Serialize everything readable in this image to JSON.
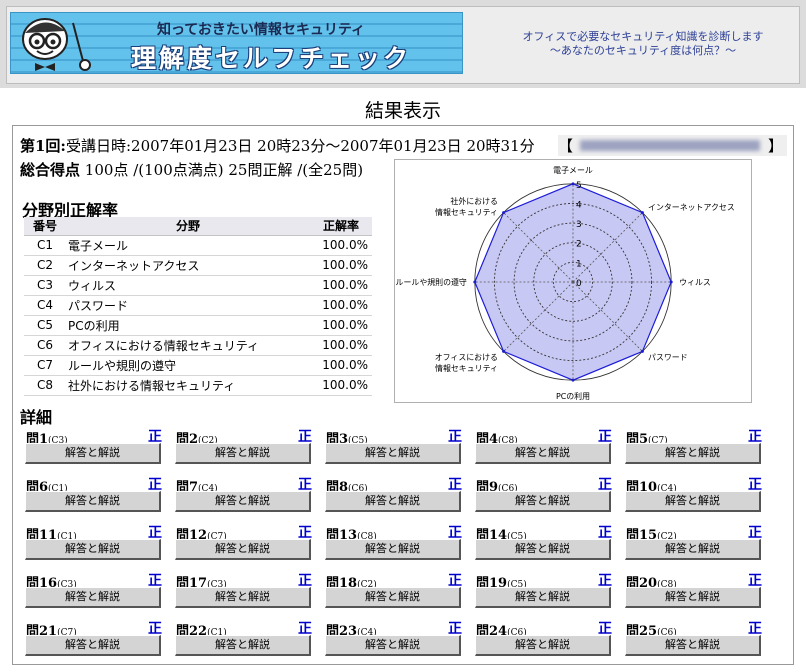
{
  "header": {
    "banner_subtitle": "知っておきたい情報セキュリティ",
    "banner_title": "理解度セルフチェック",
    "tagline_line1": "オフィスで必要なセキュリティ知識を診断します",
    "tagline_line2": "～あなたのセキュリティ度は何点？～"
  },
  "page_title": "結果表示",
  "session": {
    "label": "第1回:",
    "text": "受講日時:2007年01月23日 20時23分～2007年01月23日 20時31分",
    "email_open": "【",
    "email_close": "】"
  },
  "score": {
    "label": "総合得点",
    "text": "100点 /(100点満点) 25問正解 /(全25問)"
  },
  "rates": {
    "heading": "分野別正解率",
    "columns": [
      "番号",
      "分野",
      "正解率"
    ],
    "rows": [
      {
        "num": "C1",
        "name": "電子メール",
        "rate": "100.0%"
      },
      {
        "num": "C2",
        "name": "インターネットアクセス",
        "rate": "100.0%"
      },
      {
        "num": "C3",
        "name": "ウィルス",
        "rate": "100.0%"
      },
      {
        "num": "C4",
        "name": "パスワード",
        "rate": "100.0%"
      },
      {
        "num": "C5",
        "name": "PCの利用",
        "rate": "100.0%"
      },
      {
        "num": "C6",
        "name": "オフィスにおける情報セキュリティ",
        "rate": "100.0%"
      },
      {
        "num": "C7",
        "name": "ルールや規則の遵守",
        "rate": "100.0%"
      },
      {
        "num": "C8",
        "name": "社外における情報セキュリティ",
        "rate": "100.0%"
      }
    ]
  },
  "radar": {
    "axes": [
      "電子メール",
      "インターネットアクセス",
      "ウィルス",
      "パスワード",
      "PCの利用",
      "オフィスにおける\n情報セキュリティ",
      "ルールや規則の遵守",
      "社外における\n情報セキュリティ"
    ],
    "values": [
      5,
      5,
      5,
      5,
      5,
      5,
      5,
      5
    ],
    "max": 5,
    "ticks": [
      "0",
      "1",
      "2",
      "3",
      "4",
      "5"
    ],
    "fill_color": "#c8c8f4",
    "line_color": "#1c1cd8"
  },
  "details": {
    "heading": "詳細",
    "button_label": "解答と解説",
    "questions": [
      {
        "label": "問1",
        "cat": "(C3)",
        "mark": "正"
      },
      {
        "label": "問2",
        "cat": "(C2)",
        "mark": "正"
      },
      {
        "label": "問3",
        "cat": "(C5)",
        "mark": "正"
      },
      {
        "label": "問4",
        "cat": "(C8)",
        "mark": "正"
      },
      {
        "label": "問5",
        "cat": "(C7)",
        "mark": "正"
      },
      {
        "label": "問6",
        "cat": "(C1)",
        "mark": "正"
      },
      {
        "label": "問7",
        "cat": "(C4)",
        "mark": "正"
      },
      {
        "label": "問8",
        "cat": "(C6)",
        "mark": "正"
      },
      {
        "label": "問9",
        "cat": "(C6)",
        "mark": "正"
      },
      {
        "label": "問10",
        "cat": "(C4)",
        "mark": "正"
      },
      {
        "label": "問11",
        "cat": "(C1)",
        "mark": "正"
      },
      {
        "label": "問12",
        "cat": "(C7)",
        "mark": "正"
      },
      {
        "label": "問13",
        "cat": "(C8)",
        "mark": "正"
      },
      {
        "label": "問14",
        "cat": "(C5)",
        "mark": "正"
      },
      {
        "label": "問15",
        "cat": "(C2)",
        "mark": "正"
      },
      {
        "label": "問16",
        "cat": "(C3)",
        "mark": "正"
      },
      {
        "label": "問17",
        "cat": "(C3)",
        "mark": "正"
      },
      {
        "label": "問18",
        "cat": "(C2)",
        "mark": "正"
      },
      {
        "label": "問19",
        "cat": "(C5)",
        "mark": "正"
      },
      {
        "label": "問20",
        "cat": "(C8)",
        "mark": "正"
      },
      {
        "label": "問21",
        "cat": "(C7)",
        "mark": "正"
      },
      {
        "label": "問22",
        "cat": "(C1)",
        "mark": "正"
      },
      {
        "label": "問23",
        "cat": "(C4)",
        "mark": "正"
      },
      {
        "label": "問24",
        "cat": "(C6)",
        "mark": "正"
      },
      {
        "label": "問25",
        "cat": "(C6)",
        "mark": "正"
      }
    ]
  }
}
